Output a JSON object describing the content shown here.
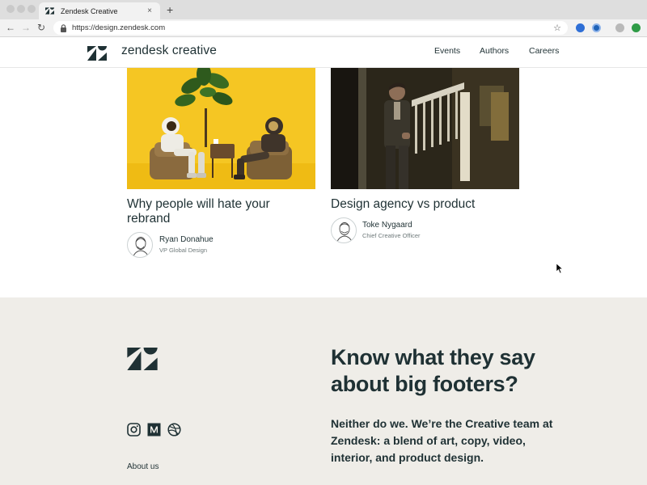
{
  "browser": {
    "tab_title": "Zendesk Creative",
    "tab_close": "×",
    "new_tab": "+",
    "back": "←",
    "forward": "→",
    "reload": "↻",
    "url": "https://design.zendesk.com",
    "bookmark": "☆"
  },
  "header": {
    "brand": "zendesk creative",
    "nav": [
      {
        "label": "Events"
      },
      {
        "label": "Authors"
      },
      {
        "label": "Careers"
      }
    ]
  },
  "articles": [
    {
      "title_line1": "Why people will hate your",
      "title_line2": "rebrand",
      "author": "Ryan Donahue",
      "role": "VP Global Design"
    },
    {
      "title_line1": "Design agency vs product",
      "author": "Toke Nygaard",
      "role": "Chief Creative Officer"
    }
  ],
  "footer": {
    "headline_line1": "Know what they say",
    "headline_line2": "about big footers?",
    "blurb_line1": "Neither do we. We’re the Creative team at",
    "blurb_line2": "Zendesk: a blend of art, copy, video,",
    "blurb_line3": "interior, and product design.",
    "about": "About us"
  },
  "colors": {
    "text": "#1f3134",
    "footer_bg": "#efede8",
    "yellow": "#f5c623"
  }
}
